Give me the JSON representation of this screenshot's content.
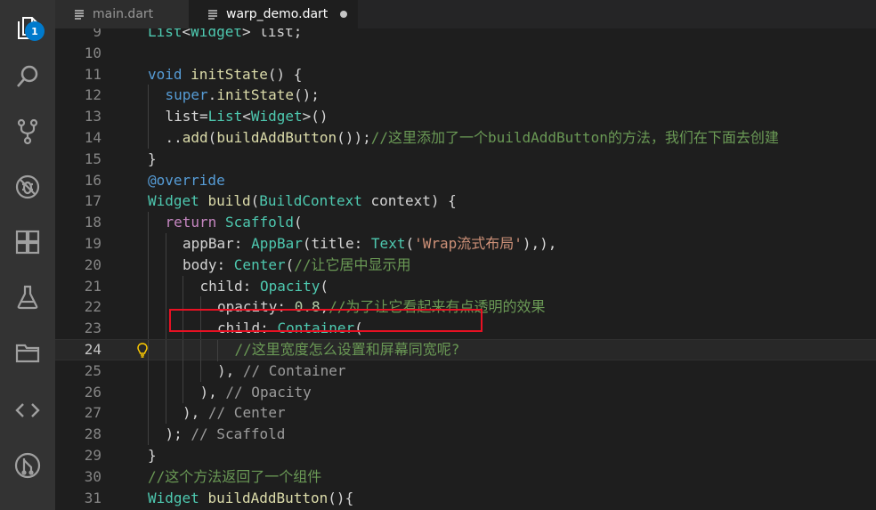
{
  "tabs": [
    {
      "label": "main.dart",
      "active": false
    },
    {
      "label": "warp_demo.dart",
      "active": true,
      "dirty": true
    }
  ],
  "activity_bar": {
    "items": [
      "explorer-icon",
      "search-icon",
      "source-control-icon",
      "debug-icon",
      "extensions-icon",
      "flask-icon",
      "folder-icon",
      "code-brackets-icon",
      "git-graph-icon"
    ],
    "explorer_badge": "1"
  },
  "colors": {
    "keyword": "#569cd6",
    "type": "#4ec9b0",
    "function": "#dcdcaa",
    "string": "#ce9178",
    "number": "#b5cea8",
    "comment": "#6a9955",
    "highlight_box": "#e81123"
  },
  "editor": {
    "current_line": "24",
    "lines": [
      {
        "num": "9",
        "segments": [
          [
            "type",
            "List"
          ],
          [
            "var",
            "<"
          ],
          [
            "type",
            "Widget"
          ],
          [
            "var",
            "> list;"
          ]
        ]
      },
      {
        "num": "10",
        "segments": []
      },
      {
        "num": "11",
        "segments": [
          [
            "kw",
            "void"
          ],
          [
            "var",
            " "
          ],
          [
            "fn",
            "initState"
          ],
          [
            "var",
            "() {"
          ]
        ]
      },
      {
        "num": "12",
        "segments": [
          [
            "kw",
            "super"
          ],
          [
            "var",
            "."
          ],
          [
            "fn",
            "initState"
          ],
          [
            "var",
            "();"
          ]
        ]
      },
      {
        "num": "13",
        "segments": [
          [
            "var",
            "list="
          ],
          [
            "type",
            "List"
          ],
          [
            "var",
            "<"
          ],
          [
            "type",
            "Widget"
          ],
          [
            "var",
            ">()"
          ]
        ]
      },
      {
        "num": "14",
        "segments": [
          [
            "var",
            ".."
          ],
          [
            "fn",
            "add"
          ],
          [
            "var",
            "("
          ],
          [
            "fn",
            "buildAddButton"
          ],
          [
            "var",
            "());"
          ],
          [
            "cmt",
            "//这里添加了一个buildAddButton的方法，我们在下面去创建"
          ]
        ]
      },
      {
        "num": "15",
        "segments": [
          [
            "var",
            "}"
          ]
        ]
      },
      {
        "num": "16",
        "segments": [
          [
            "kw",
            "@override"
          ]
        ]
      },
      {
        "num": "17",
        "segments": [
          [
            "type",
            "Widget"
          ],
          [
            "var",
            " "
          ],
          [
            "fn",
            "build"
          ],
          [
            "var",
            "("
          ],
          [
            "type",
            "BuildContext"
          ],
          [
            "var",
            " context) {"
          ]
        ]
      },
      {
        "num": "18",
        "segments": [
          [
            "ctrl",
            "return"
          ],
          [
            "var",
            " "
          ],
          [
            "type",
            "Scaffold"
          ],
          [
            "var",
            "("
          ]
        ]
      },
      {
        "num": "19",
        "segments": [
          [
            "var",
            "appBar: "
          ],
          [
            "type",
            "AppBar"
          ],
          [
            "var",
            "(title: "
          ],
          [
            "type",
            "Text"
          ],
          [
            "var",
            "("
          ],
          [
            "str",
            "'Wrap流式布局'"
          ],
          [
            "var",
            "),),"
          ]
        ]
      },
      {
        "num": "20",
        "segments": [
          [
            "var",
            "body: "
          ],
          [
            "type",
            "Center"
          ],
          [
            "var",
            "("
          ],
          [
            "cmt",
            "//让它居中显示用"
          ]
        ]
      },
      {
        "num": "21",
        "segments": [
          [
            "var",
            "child: "
          ],
          [
            "type",
            "Opacity"
          ],
          [
            "var",
            "("
          ]
        ]
      },
      {
        "num": "22",
        "segments": [
          [
            "var",
            "opacity: "
          ],
          [
            "num",
            "0.8"
          ],
          [
            "var",
            ","
          ],
          [
            "cmt",
            "//为了让它看起来有点透明的效果"
          ]
        ]
      },
      {
        "num": "23",
        "segments": [
          [
            "var",
            "child: "
          ],
          [
            "type",
            "Container"
          ],
          [
            "var",
            "("
          ]
        ]
      },
      {
        "num": "24",
        "segments": [
          [
            "cmt",
            "//这里宽度怎么设置和屏幕同宽呢?"
          ]
        ]
      },
      {
        "num": "25",
        "segments": [
          [
            "var",
            "), "
          ],
          [
            "lbl",
            "// Container"
          ]
        ]
      },
      {
        "num": "26",
        "segments": [
          [
            "var",
            "), "
          ],
          [
            "lbl",
            "// Opacity"
          ]
        ]
      },
      {
        "num": "27",
        "segments": [
          [
            "var",
            "), "
          ],
          [
            "lbl",
            "// Center"
          ]
        ]
      },
      {
        "num": "28",
        "segments": [
          [
            "var",
            "); "
          ],
          [
            "lbl",
            "// Scaffold"
          ]
        ]
      },
      {
        "num": "29",
        "segments": [
          [
            "var",
            "}"
          ]
        ]
      },
      {
        "num": "30",
        "segments": [
          [
            "cmt",
            "//这个方法返回了一个组件"
          ]
        ]
      },
      {
        "num": "31",
        "segments": [
          [
            "type",
            "Widget"
          ],
          [
            "var",
            " "
          ],
          [
            "fn",
            "buildAddButton"
          ],
          [
            "var",
            "(){"
          ]
        ]
      }
    ]
  }
}
